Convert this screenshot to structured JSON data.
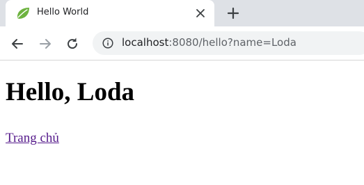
{
  "browser": {
    "tab": {
      "title": "Hello World",
      "favicon": "spring-leaf-icon",
      "close_icon": "close-icon"
    },
    "new_tab_icon": "plus-icon",
    "toolbar": {
      "back_icon": "back-arrow-icon",
      "forward_icon": "forward-arrow-icon",
      "reload_icon": "reload-icon",
      "info_icon": "info-icon",
      "url_host": "localhost",
      "url_rest": ":8080/hello?name=Loda"
    }
  },
  "page": {
    "heading": "Hello, Loda",
    "link_text": "Trang chủ"
  },
  "colors": {
    "tabstrip_bg": "#dee1e6",
    "omnibox_bg": "#f1f3f4",
    "favicon_green": "#6db33f",
    "visited_link": "#551a8b"
  }
}
